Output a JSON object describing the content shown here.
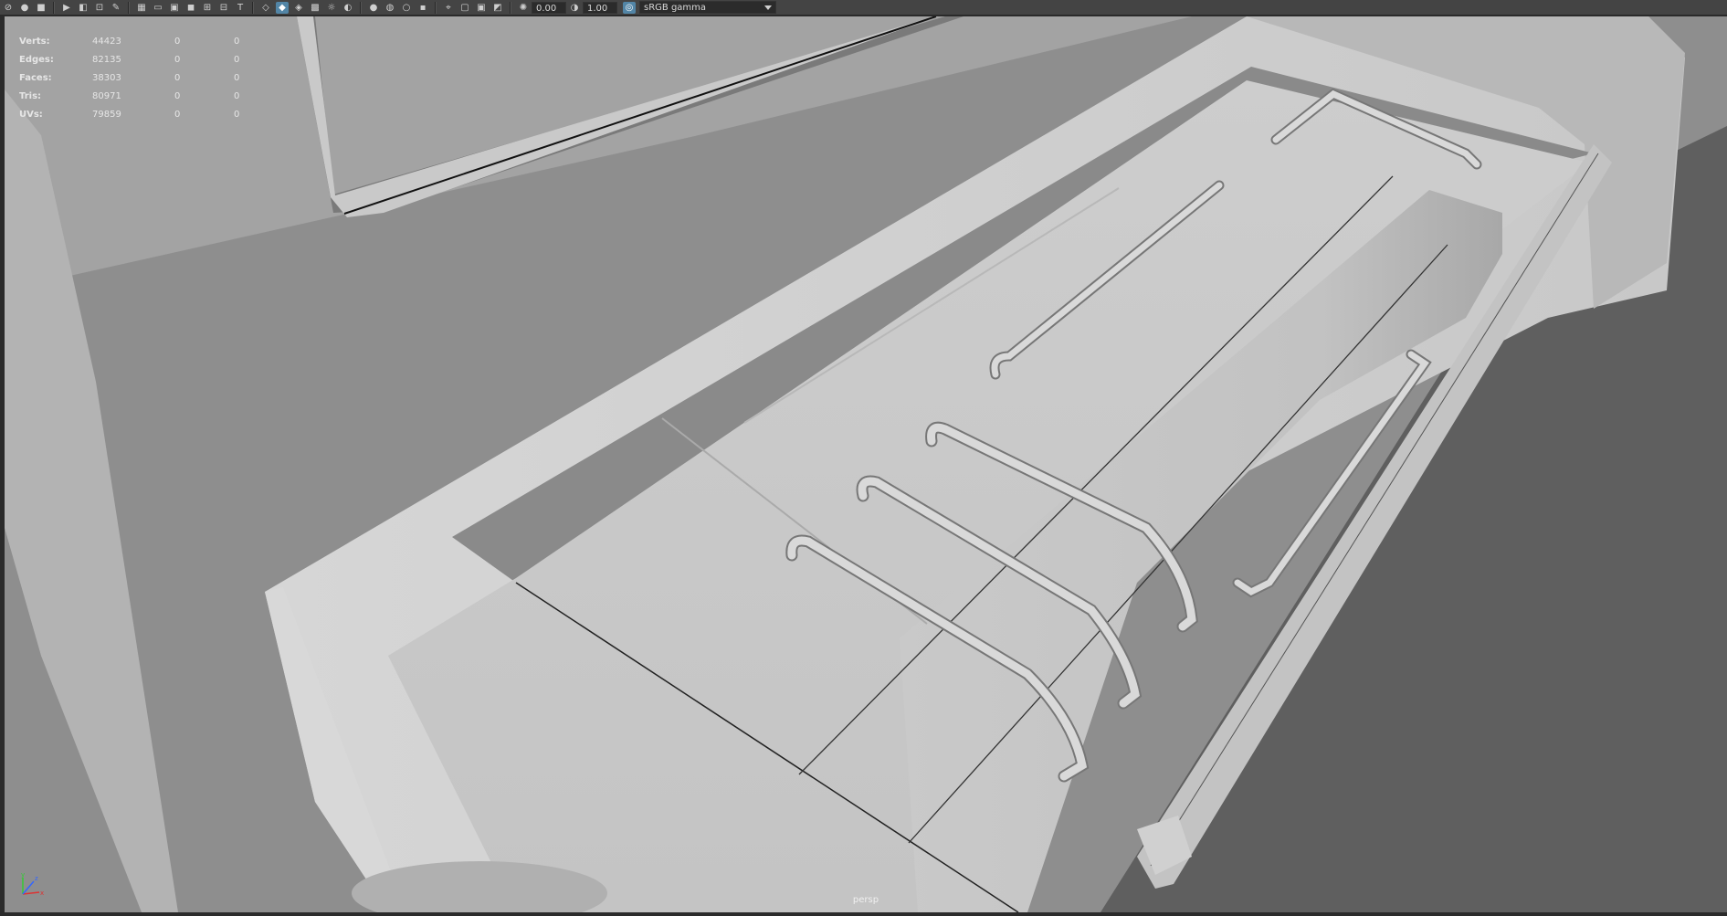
{
  "toolbar": {
    "icons": [
      "select-camera-icon",
      "lock-camera-icon",
      "bookmark-icon",
      "camera-attributes-icon",
      "image-plane-icon",
      "2d-pan-zoom-icon",
      "grease-pencil-icon",
      "grid-icon",
      "film-gate-icon",
      "resolution-gate-icon",
      "gate-mask-icon",
      "field-chart-icon",
      "safe-action-icon",
      "safe-title-icon",
      "wireframe-icon",
      "smooth-shade-icon",
      "wireframe-on-shaded-icon",
      "textured-icon",
      "use-all-lights-icon",
      "shadows-icon",
      "screen-space-ao-icon",
      "motion-blur-icon",
      "anti-aliasing-icon",
      "depth-of-field-icon",
      "isolate-select-icon",
      "xray-icon",
      "xray-joints-icon",
      "backface-culling-icon",
      "exposure-icon",
      "gamma-icon",
      "color-management-icon"
    ],
    "exposure_value": "0.00",
    "gamma_value": "1.00",
    "color_space": "sRGB gamma"
  },
  "hud": {
    "rows": [
      {
        "label": "Verts:",
        "value": "44423",
        "selected": "0",
        "uv_selected": "0"
      },
      {
        "label": "Edges:",
        "value": "82135",
        "selected": "0",
        "uv_selected": "0"
      },
      {
        "label": "Faces:",
        "value": "38303",
        "selected": "0",
        "uv_selected": "0"
      },
      {
        "label": "Tris:",
        "value": "80971",
        "selected": "0",
        "uv_selected": "0"
      },
      {
        "label": "UVs:",
        "value": "79859",
        "selected": "0",
        "uv_selected": "0"
      }
    ]
  },
  "viewport": {
    "camera": "persp",
    "axis": {
      "x": "x",
      "y": "y",
      "z": "z"
    },
    "colors": {
      "background": "#9a9a9a",
      "accent": "#5285a6",
      "x_axis": "#d33",
      "y_axis": "#3c3",
      "z_axis": "#36f"
    }
  }
}
